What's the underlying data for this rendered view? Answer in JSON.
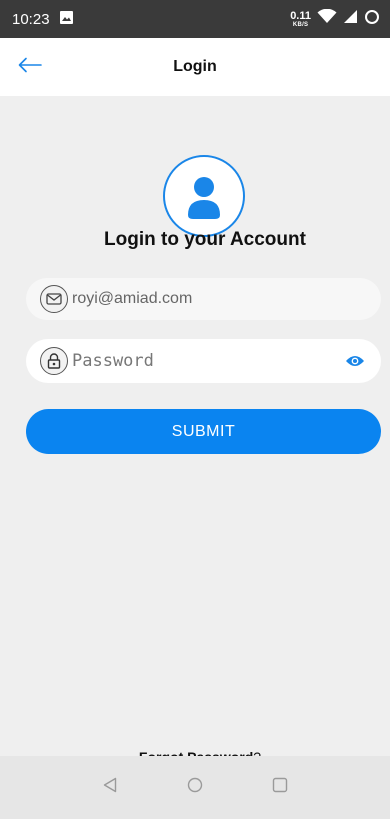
{
  "status_bar": {
    "time": "10:23",
    "net_speed": "0.11",
    "net_unit": "KB/S"
  },
  "header": {
    "title": "Login",
    "back_icon": "arrow-left-icon"
  },
  "login": {
    "heading": "Login to your Account",
    "email_placeholder": "royi@amiad.com",
    "password_placeholder": "Password",
    "submit_label": "SUBMIT",
    "forgot_link": "Forgot Password",
    "forgot_suffix": "?"
  },
  "colors": {
    "accent": "#1a86e8",
    "button": "#0a84f0",
    "background": "#efefef",
    "status_bar": "#3a3a3a"
  },
  "nav": {
    "back": "back-triangle-icon",
    "home": "home-circle-icon",
    "recents": "recents-square-icon"
  }
}
